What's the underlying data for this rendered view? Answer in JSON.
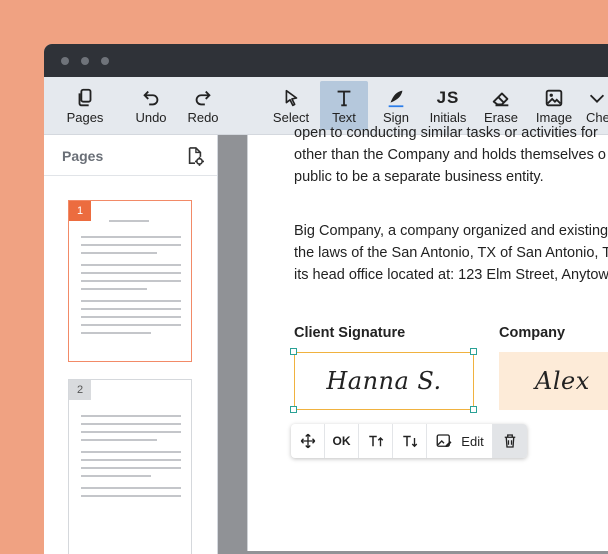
{
  "toolbar": {
    "items": [
      {
        "label": "Pages",
        "icon": "pages-icon"
      },
      {
        "label": "Undo",
        "icon": "undo-icon"
      },
      {
        "label": "Redo",
        "icon": "redo-icon"
      },
      {
        "label": "Select",
        "icon": "cursor-icon"
      },
      {
        "label": "Text",
        "icon": "text-icon",
        "active": true
      },
      {
        "label": "Sign",
        "icon": "pen-icon"
      },
      {
        "label": "Initials",
        "icon": "initials-icon"
      },
      {
        "label": "Erase",
        "icon": "eraser-icon"
      },
      {
        "label": "Image",
        "icon": "image-icon"
      },
      {
        "label": "Che",
        "icon": "chevron-down-icon"
      }
    ],
    "initials_glyph": "JS",
    "text_glyph": "T"
  },
  "sidebar": {
    "title": "Pages",
    "pages": [
      {
        "number": "1",
        "selected": true
      },
      {
        "number": "2",
        "selected": false
      }
    ]
  },
  "document": {
    "para1": [
      "open to conducting similar tasks or activities for",
      "other than the Company and holds themselves o",
      "public to be a separate business entity."
    ],
    "para2": [
      "Big Company, a company organized and existing",
      "the laws of the San Antonio, TX of San Antonio, T",
      "its head office located at: 123 Elm Street, Anytow"
    ],
    "client_signature_label": "Client Signature",
    "company_label": "Company",
    "client_signature": "Hanna S.",
    "company_signature": "Alex"
  },
  "float_toolbar": {
    "ok_label": "OK",
    "edit_label": "Edit"
  },
  "colors": {
    "background": "#f0a282",
    "accent": "#ec6c3f",
    "active_tool": "#b5c8dc",
    "selection_border": "#f0b23f",
    "handle": "#2aa196"
  }
}
